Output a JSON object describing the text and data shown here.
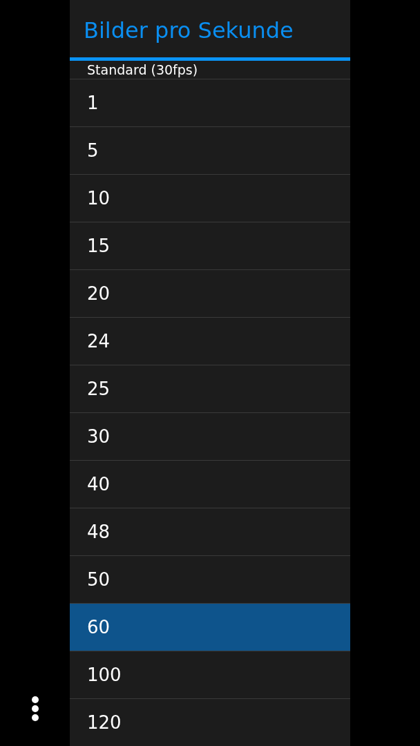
{
  "dialog": {
    "title": "Bilder pro Sekunde",
    "options": [
      {
        "kind": "partial",
        "label": "Standard (30fps)",
        "selected": false
      },
      {
        "kind": "option",
        "label": "1",
        "selected": false
      },
      {
        "kind": "option",
        "label": "5",
        "selected": false
      },
      {
        "kind": "option",
        "label": "10",
        "selected": false
      },
      {
        "kind": "option",
        "label": "15",
        "selected": false
      },
      {
        "kind": "option",
        "label": "20",
        "selected": false
      },
      {
        "kind": "option",
        "label": "24",
        "selected": false
      },
      {
        "kind": "option",
        "label": "25",
        "selected": false
      },
      {
        "kind": "option",
        "label": "30",
        "selected": false
      },
      {
        "kind": "option",
        "label": "40",
        "selected": false
      },
      {
        "kind": "option",
        "label": "48",
        "selected": false
      },
      {
        "kind": "option",
        "label": "50",
        "selected": false
      },
      {
        "kind": "option",
        "label": "60",
        "selected": true
      },
      {
        "kind": "option",
        "label": "100",
        "selected": false
      },
      {
        "kind": "option",
        "label": "120",
        "selected": false
      }
    ]
  }
}
